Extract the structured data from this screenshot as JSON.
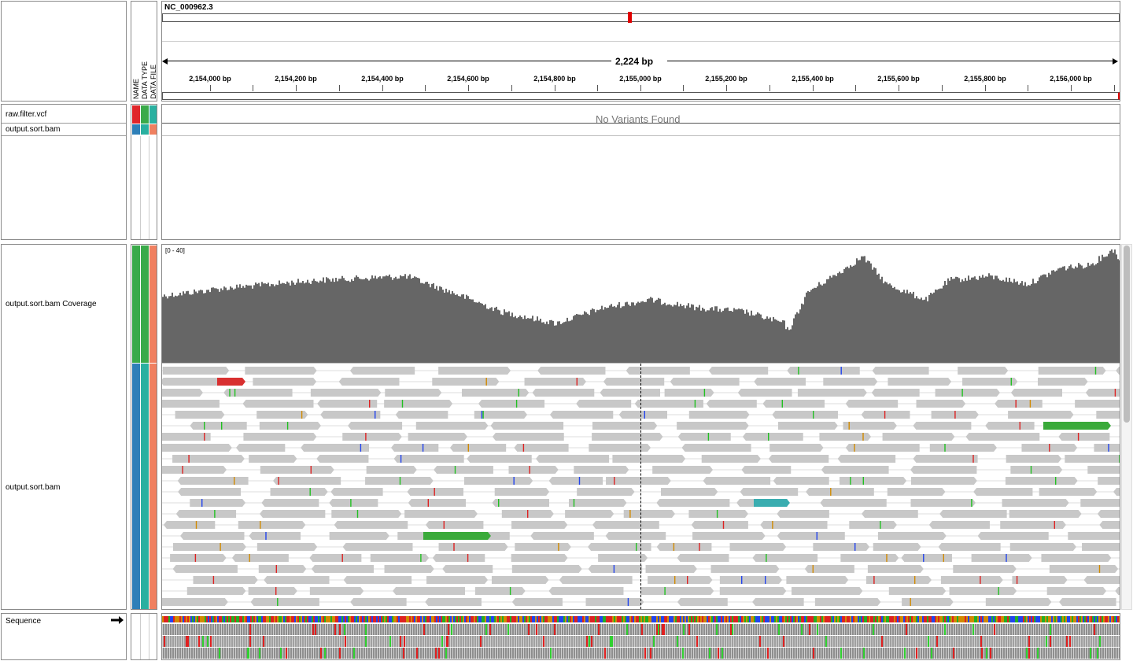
{
  "ruler": {
    "chromosome": "NC_000962.3",
    "span_label": "2,224 bp",
    "ticks": [
      {
        "label": "2,154,000 bp"
      },
      {
        "label": "2,154,200 bp"
      },
      {
        "label": "2,154,400 bp"
      },
      {
        "label": "2,154,600 bp"
      },
      {
        "label": "2,154,800 bp"
      },
      {
        "label": "2,155,000 bp"
      },
      {
        "label": "2,155,200 bp"
      },
      {
        "label": "2,155,400 bp"
      },
      {
        "label": "2,155,600 bp"
      },
      {
        "label": "2,155,800 bp"
      },
      {
        "label": "2,156,000 bp"
      }
    ]
  },
  "attribute_headers": [
    "NAME",
    "DATA TYPE",
    "DATA FILE"
  ],
  "tracks": {
    "vcf": {
      "name": "raw.filter.vcf",
      "message": "No Variants Found"
    },
    "bam_top": {
      "name": "output.sort.bam"
    },
    "coverage": {
      "name": "output.sort.bam Coverage",
      "range": "[0 - 40]"
    },
    "alignments": {
      "name": "output.sort.bam"
    },
    "sequence": {
      "name": "Sequence",
      "strand_icon": "right-arrow-icon"
    }
  },
  "colors": {
    "coverage": "#666666",
    "read": "#c8c8c8",
    "mismatch_A": "#22c022",
    "mismatch_C": "#2244ee",
    "mismatch_G": "#d18a00",
    "mismatch_T": "#dd2222",
    "attr_red": "#e0262a",
    "attr_green": "#3aaa4a",
    "attr_teal": "#2ab0a0",
    "attr_blue": "#2e7fb8",
    "attr_orange": "#f08060"
  }
}
